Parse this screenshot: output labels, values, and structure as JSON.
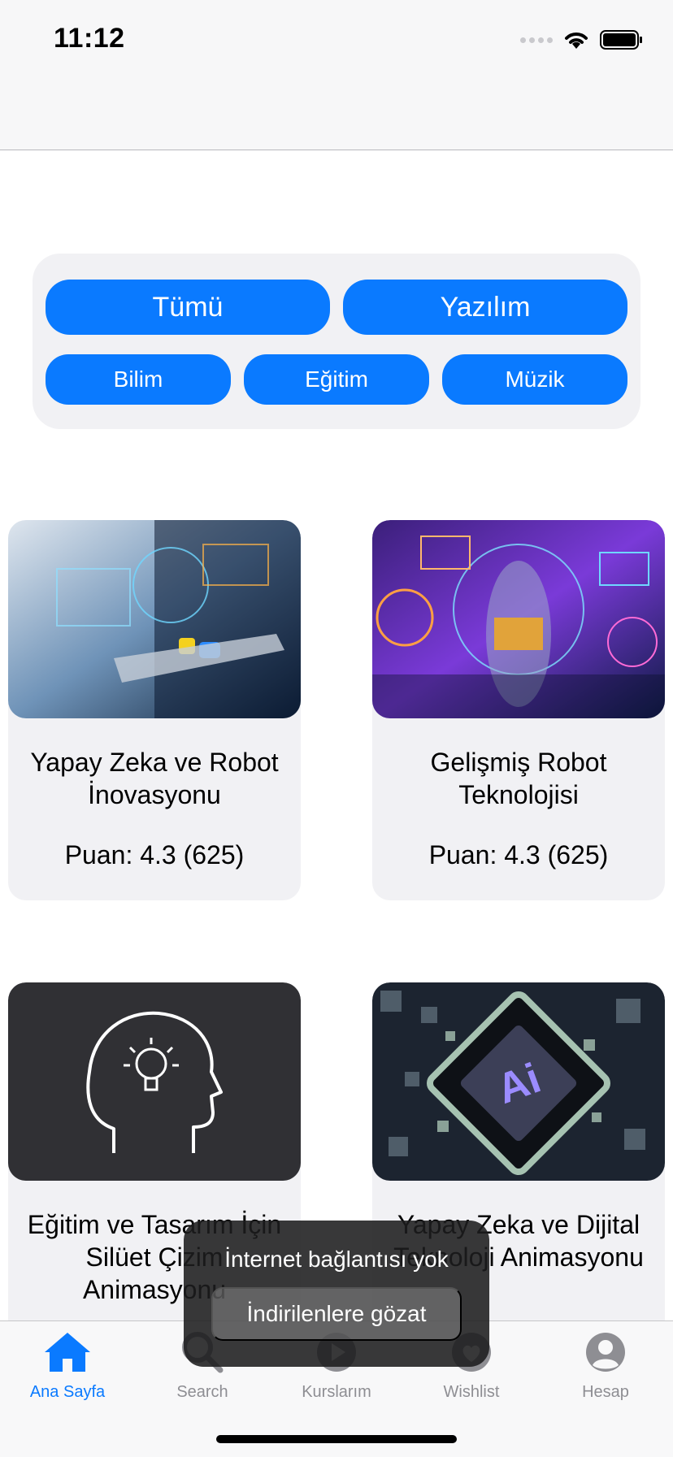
{
  "status": {
    "time": "11:12"
  },
  "filters": {
    "row1": [
      "Tümü",
      "Yazılım"
    ],
    "row2": [
      "Bilim",
      "Eğitim",
      "Müzik"
    ],
    "color": "#0a7aff"
  },
  "courses": [
    {
      "title": "Yapay Zeka ve Robot İnovasyonu",
      "rating": "Puan: 4.3 (625)"
    },
    {
      "title": "Gelişmiş Robot Teknolojisi",
      "rating": "Puan: 4.3 (625)"
    },
    {
      "title": "Eğitim ve Tasarım İçin Silüet Çizim Animasyonu",
      "rating": ""
    },
    {
      "title": "Yapay Zeka ve Dijital Teknoloji Animasyonu",
      "rating": ""
    }
  ],
  "toast": {
    "message": "İnternet bağlantısı yok",
    "action": "İndirilenlere gözat"
  },
  "tabs": [
    {
      "label": "Ana Sayfa",
      "icon": "home-icon",
      "active": true
    },
    {
      "label": "Search",
      "icon": "search-icon",
      "active": false
    },
    {
      "label": "Kurslarım",
      "icon": "play-icon",
      "active": false
    },
    {
      "label": "Wishlist",
      "icon": "heart-icon",
      "active": false
    },
    {
      "label": "Hesap",
      "icon": "account-icon",
      "active": false
    }
  ]
}
